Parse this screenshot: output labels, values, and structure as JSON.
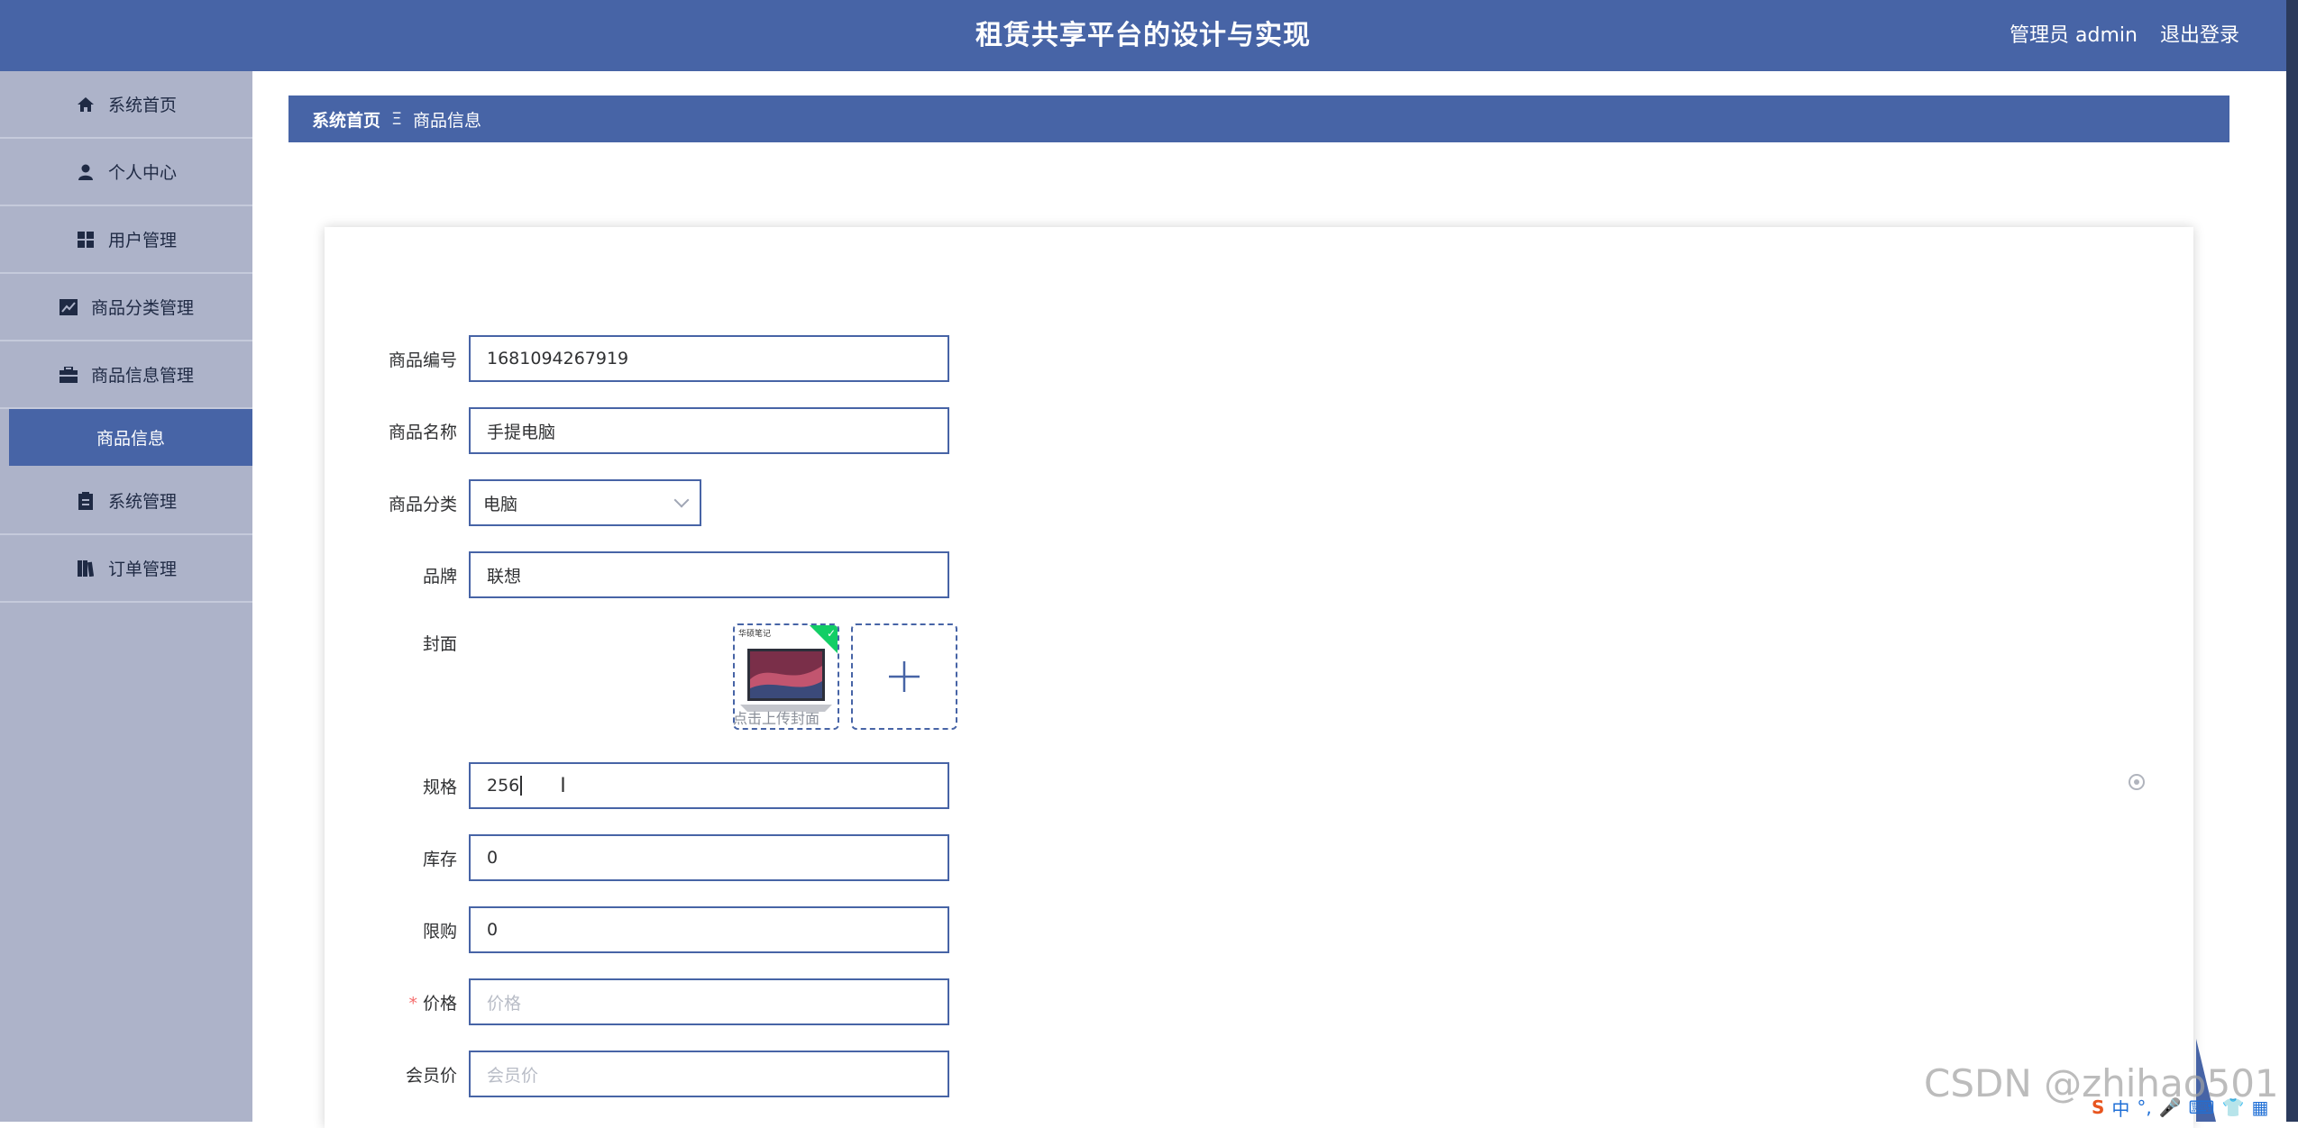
{
  "header": {
    "title": "租赁共享平台的设计与实现",
    "user_label": "管理员 admin",
    "logout_label": "退出登录"
  },
  "sidebar": {
    "items": [
      {
        "label": "系统首页",
        "icon": "home-icon"
      },
      {
        "label": "个人中心",
        "icon": "user-icon"
      },
      {
        "label": "用户管理",
        "icon": "grid-icon"
      },
      {
        "label": "商品分类管理",
        "icon": "chart-icon"
      },
      {
        "label": "商品信息管理",
        "icon": "briefcase-icon"
      },
      {
        "label": "商品信息",
        "icon": "",
        "active": true
      },
      {
        "label": "系统管理",
        "icon": "clipboard-icon"
      },
      {
        "label": "订单管理",
        "icon": "book-icon"
      }
    ]
  },
  "breadcrumb": {
    "home": "系统首页",
    "separator": "Ξ",
    "current": "商品信息"
  },
  "form": {
    "code": {
      "label": "商品编号",
      "value": "1681094267919"
    },
    "name": {
      "label": "商品名称",
      "value": "手提电脑"
    },
    "category": {
      "label": "商品分类",
      "value": "电脑"
    },
    "brand": {
      "label": "品牌",
      "value": "联想"
    },
    "cover": {
      "label": "封面",
      "hint": "点击上传封面",
      "thumb_caption": "华硕笔记"
    },
    "spec": {
      "label": "规格",
      "value": "256"
    },
    "stock": {
      "label": "库存",
      "value": "0"
    },
    "limit": {
      "label": "限购",
      "value": "0"
    },
    "price": {
      "label": "价格",
      "placeholder": "价格",
      "required_mark": "*"
    },
    "member_price": {
      "label": "会员价",
      "placeholder": "会员价"
    }
  },
  "watermark": "CSDN @zhihao501",
  "tray": {
    "ime": "中"
  },
  "colors": {
    "primary": "#4764a6",
    "sidebar": "#adb3c9",
    "success": "#13ce66",
    "required": "#f56c6c"
  }
}
